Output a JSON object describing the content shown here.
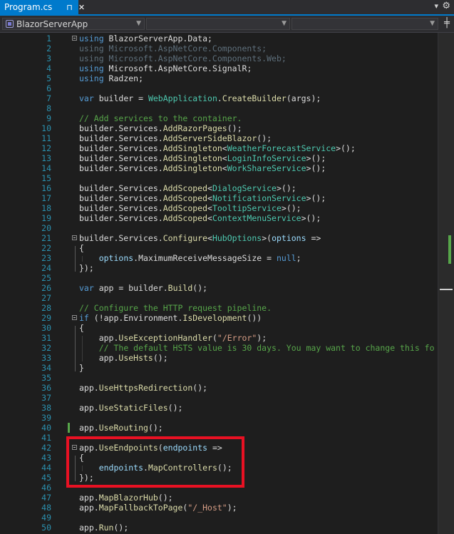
{
  "tab": {
    "title": "Program.cs",
    "pin_icon": "pin-icon",
    "close_icon": "close-icon"
  },
  "tab_menu_icon": "dropdown-icon",
  "settings_icon": "gear-icon",
  "navbar": {
    "project": "BlazorServerApp",
    "type_member": "",
    "member": "",
    "split_icon": "split-editor-icon"
  },
  "colors": {
    "accent": "#007acc",
    "keyword": "#569cd6",
    "type": "#4ec9b0",
    "method": "#dcdcaa",
    "comment": "#57a64a",
    "string": "#d69d85",
    "highlight_box": "#e81123"
  },
  "lines": [
    {
      "n": "1",
      "fold": true,
      "t": [
        [
          "kw",
          "using"
        ],
        [
          "",
          "Â BlazorServerApp.Data;"
        ]
      ]
    },
    {
      "n": "2",
      "t": [
        [
          "dim",
          "using Microsoft.AspNetCore.Components;"
        ]
      ]
    },
    {
      "n": "3",
      "t": [
        [
          "dim",
          "using Microsoft.AspNetCore.Components.Web;"
        ]
      ]
    },
    {
      "n": "4",
      "t": [
        [
          "kw",
          "using"
        ],
        [
          "",
          " Microsoft.AspNetCore.SignalR;"
        ]
      ]
    },
    {
      "n": "5",
      "t": [
        [
          "kw",
          "using"
        ],
        [
          "",
          " Radzen;"
        ]
      ]
    },
    {
      "n": "6",
      "t": []
    },
    {
      "n": "7",
      "t": [
        [
          "kw",
          "var"
        ],
        [
          "",
          " builder = "
        ],
        [
          "ty",
          "WebApplication"
        ],
        [
          ".",
          ""
        ],
        [
          "mt",
          "CreateBuilder"
        ],
        [
          "",
          "(args);"
        ]
      ]
    },
    {
      "n": "8",
      "t": []
    },
    {
      "n": "9",
      "t": [
        [
          "cm",
          "// Add services to the container."
        ]
      ]
    },
    {
      "n": "10",
      "t": [
        [
          "",
          "builder.Services."
        ],
        [
          "mt",
          "AddRazorPages"
        ],
        [
          "",
          "();"
        ]
      ]
    },
    {
      "n": "11",
      "t": [
        [
          "",
          "builder.Services."
        ],
        [
          "mt",
          "AddServerSideBlazor"
        ],
        [
          "",
          "();"
        ]
      ]
    },
    {
      "n": "12",
      "t": [
        [
          "",
          "builder.Services."
        ],
        [
          "mt",
          "AddSingleton"
        ],
        [
          "",
          "<"
        ],
        [
          "ty",
          "WeatherForecastService"
        ],
        [
          "",
          ">();"
        ]
      ]
    },
    {
      "n": "13",
      "t": [
        [
          "",
          "builder.Services."
        ],
        [
          "mt",
          "AddSingleton"
        ],
        [
          "",
          "<"
        ],
        [
          "ty",
          "LoginInfoService"
        ],
        [
          "",
          ">();"
        ]
      ]
    },
    {
      "n": "14",
      "t": [
        [
          "",
          "builder.Services."
        ],
        [
          "mt",
          "AddSingleton"
        ],
        [
          "",
          "<"
        ],
        [
          "ty",
          "WorkShareService"
        ],
        [
          "",
          ">();"
        ]
      ]
    },
    {
      "n": "15",
      "t": []
    },
    {
      "n": "16",
      "t": [
        [
          "",
          "builder.Services."
        ],
        [
          "mt",
          "AddScoped"
        ],
        [
          "",
          "<"
        ],
        [
          "ty",
          "DialogService"
        ],
        [
          "",
          ">();"
        ]
      ]
    },
    {
      "n": "17",
      "t": [
        [
          "",
          "builder.Services."
        ],
        [
          "mt",
          "AddScoped"
        ],
        [
          "",
          "<"
        ],
        [
          "ty",
          "NotificationService"
        ],
        [
          "",
          ">();"
        ]
      ]
    },
    {
      "n": "18",
      "t": [
        [
          "",
          "builder.Services."
        ],
        [
          "mt",
          "AddScoped"
        ],
        [
          "",
          "<"
        ],
        [
          "ty",
          "TooltipService"
        ],
        [
          "",
          ">();"
        ]
      ]
    },
    {
      "n": "19",
      "t": [
        [
          "",
          "builder.Services."
        ],
        [
          "mt",
          "AddScoped"
        ],
        [
          "",
          "<"
        ],
        [
          "ty",
          "ContextMenuService"
        ],
        [
          "",
          ">();"
        ]
      ]
    },
    {
      "n": "20",
      "t": []
    },
    {
      "n": "21",
      "fold": true,
      "t": [
        [
          "",
          "builder.Services."
        ],
        [
          "mt",
          "Configure"
        ],
        [
          "",
          "<"
        ],
        [
          "ty",
          "HubOptions"
        ],
        [
          "",
          ">("
        ],
        [
          "id",
          "options"
        ],
        [
          "",
          " =>"
        ]
      ]
    },
    {
      "n": "22",
      "t": [
        [
          "",
          "{"
        ]
      ]
    },
    {
      "n": "23",
      "t": [
        [
          "",
          "    "
        ],
        [
          "id",
          "options"
        ],
        [
          "",
          ".MaximumReceiveMessageSize = "
        ],
        [
          "kw",
          "null"
        ],
        [
          "",
          ";"
        ]
      ]
    },
    {
      "n": "24",
      "t": [
        [
          "",
          "});"
        ]
      ]
    },
    {
      "n": "25",
      "t": []
    },
    {
      "n": "26",
      "t": [
        [
          "kw",
          "var"
        ],
        [
          "",
          " app = builder."
        ],
        [
          "mt",
          "Build"
        ],
        [
          "",
          "();"
        ]
      ]
    },
    {
      "n": "27",
      "t": []
    },
    {
      "n": "28",
      "t": [
        [
          "cm",
          "// Configure the HTTP request pipeline."
        ]
      ]
    },
    {
      "n": "29",
      "fold": true,
      "t": [
        [
          "kw",
          "if"
        ],
        [
          "",
          " (!app.Environment."
        ],
        [
          "mt",
          "IsDevelopment"
        ],
        [
          "",
          "())"
        ]
      ]
    },
    {
      "n": "30",
      "t": [
        [
          "",
          "{"
        ]
      ]
    },
    {
      "n": "31",
      "t": [
        [
          "",
          "    app."
        ],
        [
          "mt",
          "UseExceptionHandler"
        ],
        [
          "",
          "("
        ],
        [
          "st",
          "\"/Error\""
        ],
        [
          "",
          ");"
        ]
      ]
    },
    {
      "n": "32",
      "t": [
        [
          "",
          "    "
        ],
        [
          "cm",
          "// The default HSTS value is 30 days. You may want to change this fo"
        ]
      ]
    },
    {
      "n": "33",
      "t": [
        [
          "",
          "    app."
        ],
        [
          "mt",
          "UseHsts"
        ],
        [
          "",
          "();"
        ]
      ]
    },
    {
      "n": "34",
      "t": [
        [
          "",
          "}"
        ]
      ]
    },
    {
      "n": "35",
      "t": []
    },
    {
      "n": "36",
      "t": [
        [
          "",
          "app."
        ],
        [
          "mt",
          "UseHttpsRedirection"
        ],
        [
          "",
          "();"
        ]
      ]
    },
    {
      "n": "37",
      "t": []
    },
    {
      "n": "38",
      "t": [
        [
          "",
          "app."
        ],
        [
          "mt",
          "UseStaticFiles"
        ],
        [
          "",
          "();"
        ]
      ]
    },
    {
      "n": "39",
      "t": []
    },
    {
      "n": "40",
      "t": [
        [
          "",
          "app."
        ],
        [
          "mt",
          "UseRouting"
        ],
        [
          "",
          "();"
        ]
      ]
    },
    {
      "n": "41",
      "t": []
    },
    {
      "n": "42",
      "fold": true,
      "t": [
        [
          "",
          "app."
        ],
        [
          "mt",
          "UseEndpoints"
        ],
        [
          "",
          "("
        ],
        [
          "id",
          "endpoints"
        ],
        [
          "",
          " =>"
        ]
      ]
    },
    {
      "n": "43",
      "t": [
        [
          "",
          "{"
        ]
      ]
    },
    {
      "n": "44",
      "t": [
        [
          "",
          "    "
        ],
        [
          "id",
          "endpoints"
        ],
        [
          "",
          "."
        ],
        [
          "mt",
          "MapControllers"
        ],
        [
          "",
          "();"
        ]
      ]
    },
    {
      "n": "45",
      "t": [
        [
          "",
          "});"
        ]
      ]
    },
    {
      "n": "46",
      "t": []
    },
    {
      "n": "47",
      "t": [
        [
          "",
          "app."
        ],
        [
          "mt",
          "MapBlazorHub"
        ],
        [
          "",
          "();"
        ]
      ]
    },
    {
      "n": "48",
      "t": [
        [
          "",
          "app."
        ],
        [
          "mt",
          "MapFallbackToPage"
        ],
        [
          "",
          "("
        ],
        [
          "st",
          "\"/_Host\""
        ],
        [
          "",
          ");"
        ]
      ]
    },
    {
      "n": "49",
      "t": []
    },
    {
      "n": "50",
      "t": [
        [
          "",
          "app."
        ],
        [
          "mt",
          "Run"
        ],
        [
          "",
          "();"
        ]
      ]
    }
  ]
}
